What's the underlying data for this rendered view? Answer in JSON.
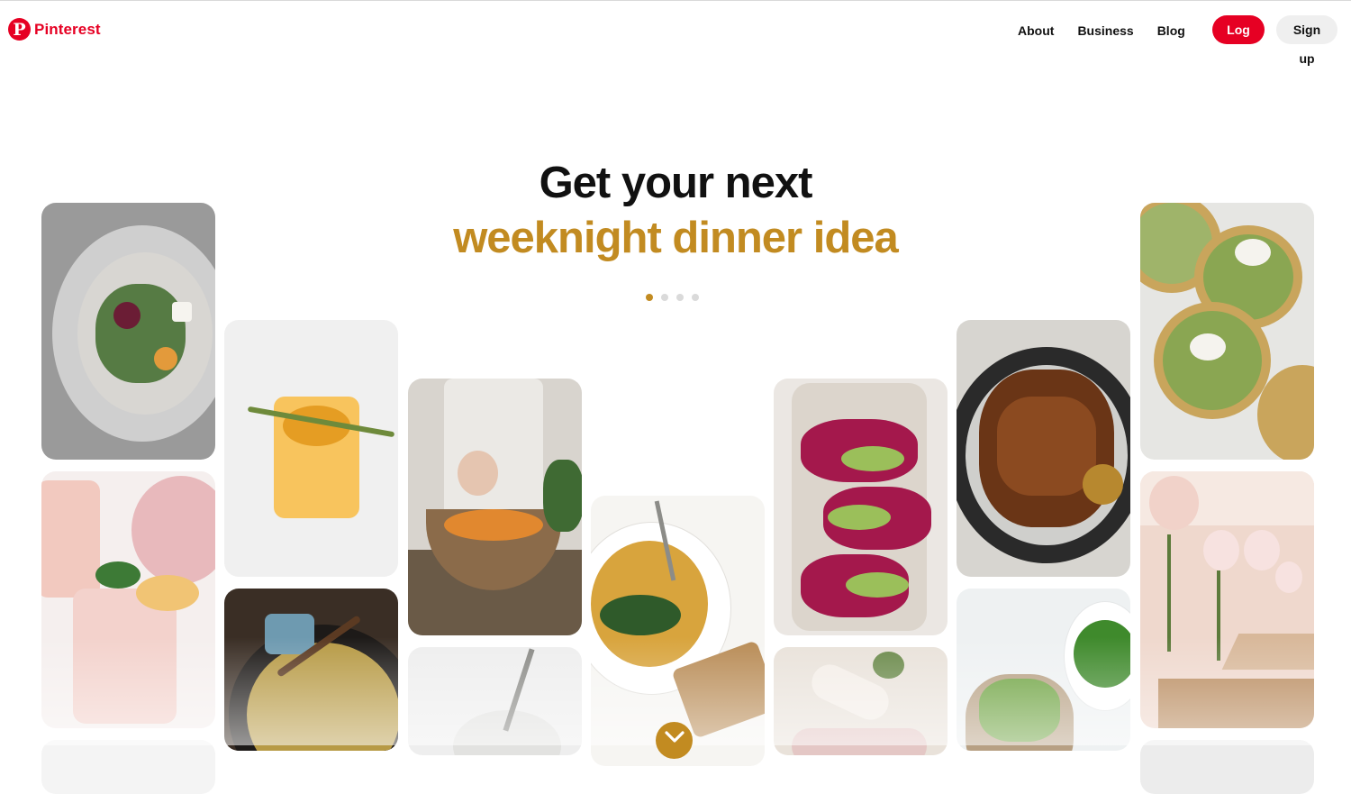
{
  "brand": {
    "name": "Pinterest",
    "logo_letter": "P",
    "color": "#e60023"
  },
  "nav": {
    "about": "About",
    "business": "Business",
    "blog": "Blog"
  },
  "auth": {
    "login": "Log in",
    "signup": "Sign up"
  },
  "hero": {
    "line1": "Get your next",
    "line2": "weeknight dinner idea",
    "accent_color": "#c28b21",
    "carousel_total": 4,
    "carousel_active_index": 0
  },
  "tiles": [
    {
      "name": "beet-salad-image",
      "bg": "#8f8f8f"
    },
    {
      "name": "pink-lemonade-image",
      "bg": "#f2e8e6"
    },
    {
      "name": "lemon-cocktail-image",
      "bg": "#f2f2f2"
    },
    {
      "name": "frittata-skillet-image",
      "bg": "#3a3026"
    },
    {
      "name": "salad-bowl-image",
      "bg": "#5a4a3a"
    },
    {
      "name": "soup-bowl-image",
      "bg": "#efefef"
    },
    {
      "name": "hummus-bowl-image",
      "bg": "#f7f6f3"
    },
    {
      "name": "beet-avocado-toast-image",
      "bg": "#ebe7e3"
    },
    {
      "name": "wraps-image",
      "bg": "#eae2dc"
    },
    {
      "name": "grilled-chicken-image",
      "bg": "#d9d7d2"
    },
    {
      "name": "pea-toast-image",
      "bg": "#f1f3f3"
    },
    {
      "name": "chickpea-flatbread-image",
      "bg": "#e8e7e3"
    },
    {
      "name": "party-room-image",
      "bg": "#ecd8ce"
    }
  ],
  "icons": {
    "scroll_down": "chevron-down-icon"
  }
}
